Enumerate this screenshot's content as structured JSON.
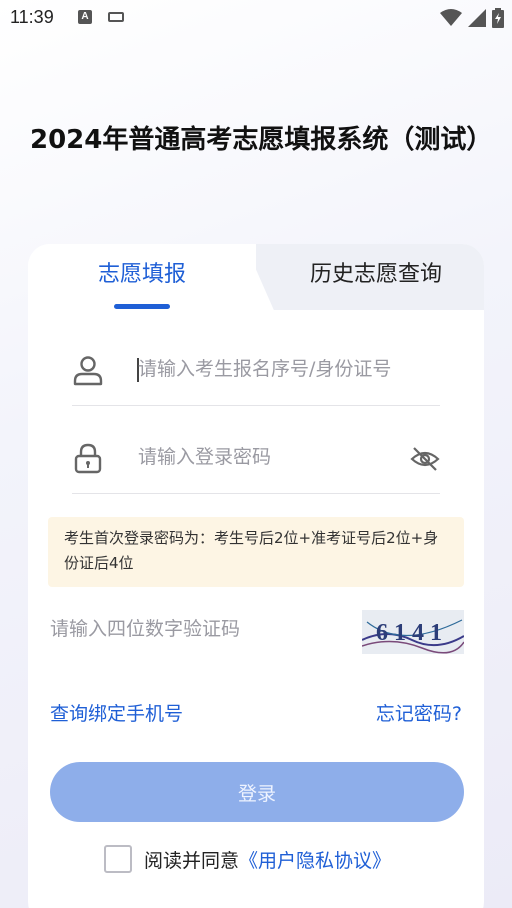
{
  "status_bar": {
    "time": "11:39",
    "left_icons": [
      "notification-a-icon",
      "keyboard-icon"
    ],
    "right_icons": [
      "wifi-icon",
      "signal-icon",
      "battery-charging-icon"
    ]
  },
  "page_title": "2024年普通高考志愿填报系统（测试）",
  "tabs": [
    {
      "label": "志愿填报",
      "active": true
    },
    {
      "label": "历史志愿查询",
      "active": false
    }
  ],
  "form": {
    "id_placeholder": "请输入考生报名序号/身份证号",
    "password_placeholder": "请输入登录密码",
    "notice": "考生首次登录密码为：考生号后2位+准考证号后2位+身份证后4位",
    "captcha_placeholder": "请输入四位数字验证码",
    "captcha_text": "6141"
  },
  "links": {
    "bind_phone": "查询绑定手机号",
    "forgot_password": "忘记密码?"
  },
  "login_button": "登录",
  "agreement": {
    "prefix": "阅读并同意",
    "link": "《用户隐私协议》",
    "checked": false
  },
  "colors": {
    "accent": "#1f5fd6",
    "login_button_bg": "#8eaeea",
    "notice_bg": "#fdf5e4"
  }
}
